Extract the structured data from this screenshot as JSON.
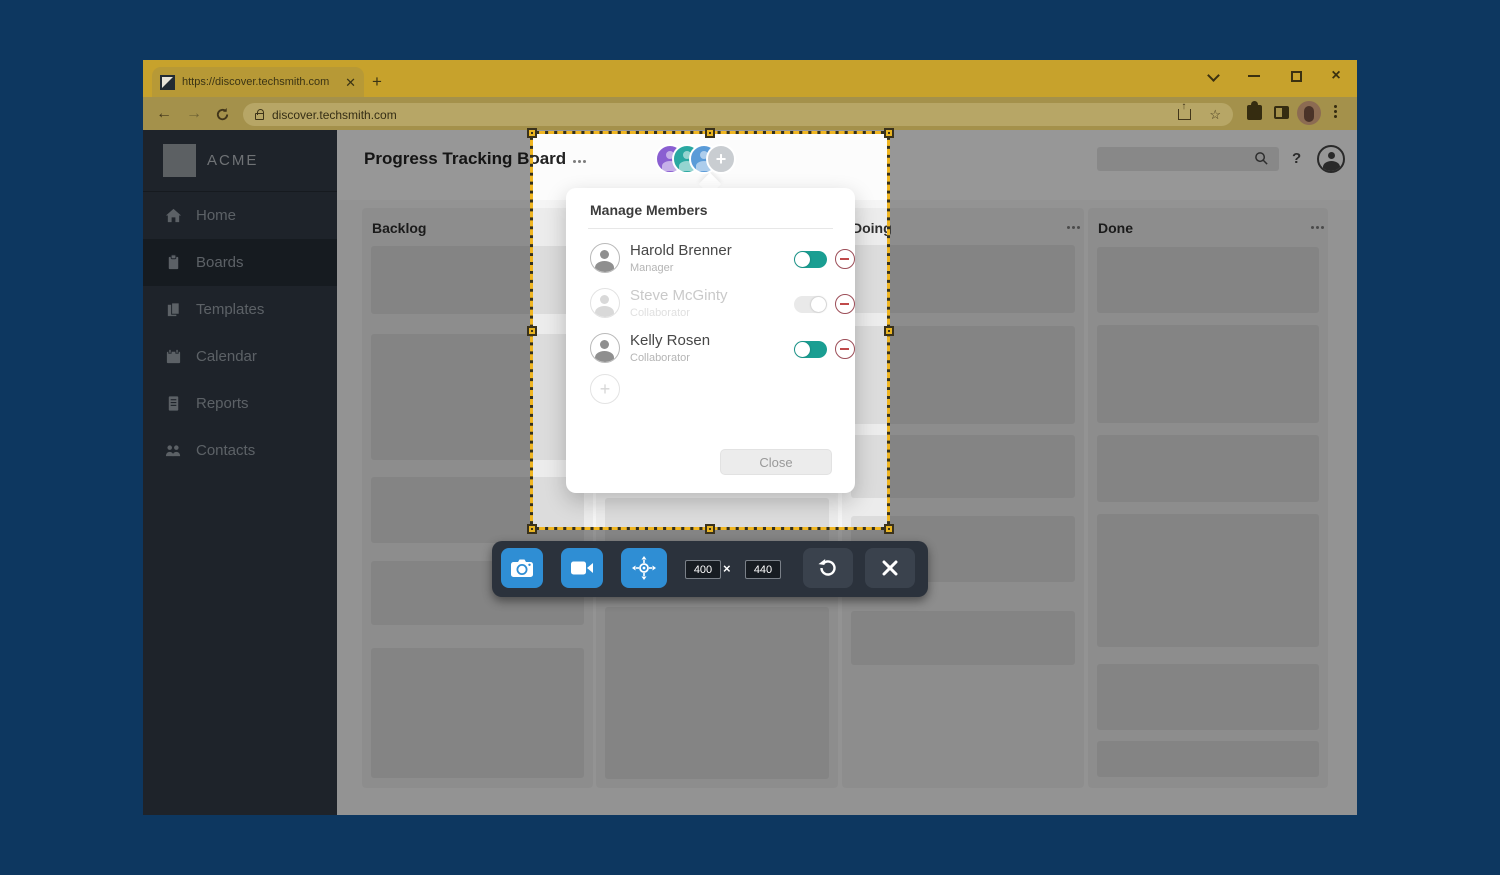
{
  "browser": {
    "tab_title": "https://discover.techsmith.com",
    "url": "discover.techsmith.com",
    "new_tab_label": "+"
  },
  "sidebar": {
    "brand": "ACME",
    "items": [
      {
        "label": "Home",
        "icon": "home-icon",
        "active": false
      },
      {
        "label": "Boards",
        "icon": "boards-icon",
        "active": true
      },
      {
        "label": "Templates",
        "icon": "templates-icon",
        "active": false
      },
      {
        "label": "Calendar",
        "icon": "calendar-icon",
        "active": false
      },
      {
        "label": "Reports",
        "icon": "reports-icon",
        "active": false
      },
      {
        "label": "Contacts",
        "icon": "contacts-icon",
        "active": false
      }
    ]
  },
  "header": {
    "title": "Progress Tracking Board",
    "help_label": "?",
    "search_placeholder": ""
  },
  "board": {
    "columns": [
      {
        "label": "Backlog"
      },
      {
        "label": ""
      },
      {
        "label": "Doing"
      },
      {
        "label": "Done"
      }
    ]
  },
  "popup": {
    "title": "Manage Members",
    "close_label": "Close",
    "add_label": "+",
    "members": [
      {
        "name": "Harold Brenner",
        "role": "Manager",
        "enabled": true,
        "faded": false
      },
      {
        "name": "Steve McGinty",
        "role": "Collaborator",
        "enabled": false,
        "faded": true
      },
      {
        "name": "Kelly Rosen",
        "role": "Collaborator",
        "enabled": true,
        "faded": false
      }
    ]
  },
  "capture": {
    "width_value": "400",
    "height_value": "440",
    "times_label": "×"
  },
  "colors": {
    "chrome_gold": "#c7a22c",
    "toolbar_olive": "#a4914b",
    "desktop_navy": "#0d3760",
    "accent_blue": "#2f8ed4",
    "toggle_on_teal": "#1a9e92",
    "selection_gold": "#f0b622",
    "avatar_purple": "#8a5fd1",
    "avatar_teal": "#2aa8a1",
    "avatar_blue": "#5a9bd8",
    "remove_maroon": "#9c4e58"
  }
}
